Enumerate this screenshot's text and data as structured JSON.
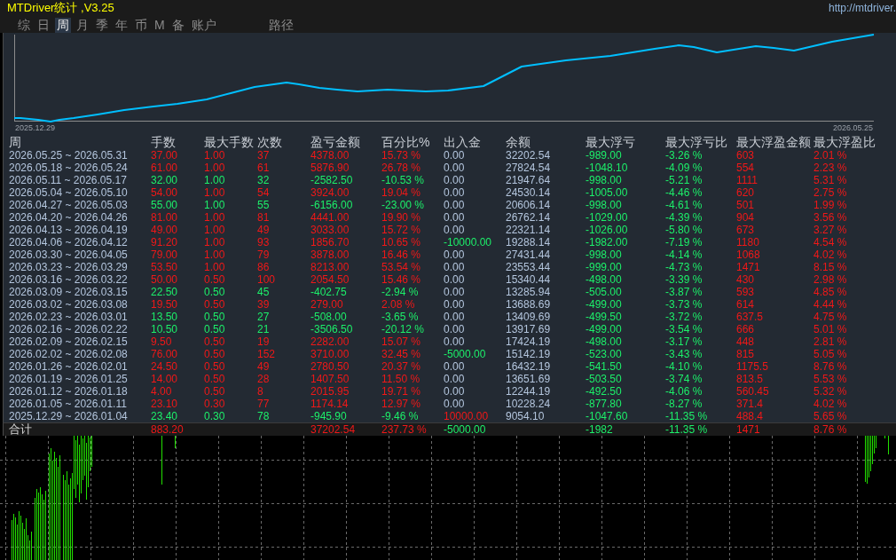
{
  "window": {
    "title": "MTDriver统计 ,V3.25",
    "url": "http://mtdriver."
  },
  "tabs": [
    {
      "label": "综",
      "selected": false
    },
    {
      "label": "日",
      "selected": false
    },
    {
      "label": "周",
      "selected": true
    },
    {
      "label": "月",
      "selected": false
    },
    {
      "label": "季",
      "selected": false
    },
    {
      "label": "年",
      "selected": false
    },
    {
      "label": "币",
      "selected": false
    },
    {
      "label": "M",
      "selected": false
    },
    {
      "label": "备",
      "selected": false
    },
    {
      "label": "账户",
      "selected": false
    }
  ],
  "path_button": {
    "label": "路径"
  },
  "equity_chart": {
    "start_label": "2025.12.29",
    "end_label": "2026.05.25"
  },
  "table": {
    "columns": [
      "周",
      "手数",
      "最大手数",
      "次数",
      "盈亏金额",
      "百分比%",
      "出入金",
      "余额",
      "最大浮亏",
      "最大浮亏比",
      "最大浮盈金额",
      "最大浮盈比"
    ],
    "rows": [
      {
        "week": "2026.05.25 ~ 2026.05.31",
        "lots": "37.00",
        "max_lots": "1.00",
        "trades": "37",
        "profit": "4378.00",
        "percent": "15.73 %",
        "transfer": "0.00",
        "balance": "32202.54",
        "max_drawdown": "-989.00",
        "max_drawdown_pct": "-3.26 %",
        "max_floating_profit": "603",
        "max_floating_profit_pct": "2.01 %",
        "loss": false,
        "deposit": false,
        "withdrawal": false
      },
      {
        "week": "2026.05.18 ~ 2026.05.24",
        "lots": "61.00",
        "max_lots": "1.00",
        "trades": "61",
        "profit": "5876.90",
        "percent": "26.78 %",
        "transfer": "0.00",
        "balance": "27824.54",
        "max_drawdown": "-1048.10",
        "max_drawdown_pct": "-4.09 %",
        "max_floating_profit": "554",
        "max_floating_profit_pct": "2.23 %",
        "loss": false,
        "deposit": false,
        "withdrawal": false
      },
      {
        "week": "2026.05.11 ~ 2026.05.17",
        "lots": "32.00",
        "max_lots": "1.00",
        "trades": "32",
        "profit": "-2582.50",
        "percent": "-10.53 %",
        "transfer": "0.00",
        "balance": "21947.64",
        "max_drawdown": "-998.00",
        "max_drawdown_pct": "-5.21 %",
        "max_floating_profit": "1111",
        "max_floating_profit_pct": "5.31 %",
        "loss": true,
        "deposit": false,
        "withdrawal": false
      },
      {
        "week": "2026.05.04 ~ 2026.05.10",
        "lots": "54.00",
        "max_lots": "1.00",
        "trades": "54",
        "profit": "3924.00",
        "percent": "19.04 %",
        "transfer": "0.00",
        "balance": "24530.14",
        "max_drawdown": "-1005.00",
        "max_drawdown_pct": "-4.46 %",
        "max_floating_profit": "620",
        "max_floating_profit_pct": "2.75 %",
        "loss": false,
        "deposit": false,
        "withdrawal": false
      },
      {
        "week": "2026.04.27 ~ 2026.05.03",
        "lots": "55.00",
        "max_lots": "1.00",
        "trades": "55",
        "profit": "-6156.00",
        "percent": "-23.00 %",
        "transfer": "0.00",
        "balance": "20606.14",
        "max_drawdown": "-998.00",
        "max_drawdown_pct": "-4.61 %",
        "max_floating_profit": "501",
        "max_floating_profit_pct": "1.99 %",
        "loss": true,
        "deposit": false,
        "withdrawal": false
      },
      {
        "week": "2026.04.20 ~ 2026.04.26",
        "lots": "81.00",
        "max_lots": "1.00",
        "trades": "81",
        "profit": "4441.00",
        "percent": "19.90 %",
        "transfer": "0.00",
        "balance": "26762.14",
        "max_drawdown": "-1029.00",
        "max_drawdown_pct": "-4.39 %",
        "max_floating_profit": "904",
        "max_floating_profit_pct": "3.56 %",
        "loss": false,
        "deposit": false,
        "withdrawal": false
      },
      {
        "week": "2026.04.13 ~ 2026.04.19",
        "lots": "49.00",
        "max_lots": "1.00",
        "trades": "49",
        "profit": "3033.00",
        "percent": "15.72 %",
        "transfer": "0.00",
        "balance": "22321.14",
        "max_drawdown": "-1026.00",
        "max_drawdown_pct": "-5.80 %",
        "max_floating_profit": "673",
        "max_floating_profit_pct": "3.27 %",
        "loss": false,
        "deposit": false,
        "withdrawal": false
      },
      {
        "week": "2026.04.06 ~ 2026.04.12",
        "lots": "91.20",
        "max_lots": "1.00",
        "trades": "93",
        "profit": "1856.70",
        "percent": "10.65 %",
        "transfer": "-10000.00",
        "balance": "19288.14",
        "max_drawdown": "-1982.00",
        "max_drawdown_pct": "-7.19 %",
        "max_floating_profit": "1180",
        "max_floating_profit_pct": "4.54 %",
        "loss": false,
        "deposit": false,
        "withdrawal": true
      },
      {
        "week": "2026.03.30 ~ 2026.04.05",
        "lots": "79.00",
        "max_lots": "1.00",
        "trades": "79",
        "profit": "3878.00",
        "percent": "16.46 %",
        "transfer": "0.00",
        "balance": "27431.44",
        "max_drawdown": "-998.00",
        "max_drawdown_pct": "-4.14 %",
        "max_floating_profit": "1068",
        "max_floating_profit_pct": "4.02 %",
        "loss": false,
        "deposit": false,
        "withdrawal": false
      },
      {
        "week": "2026.03.23 ~ 2026.03.29",
        "lots": "53.50",
        "max_lots": "1.00",
        "trades": "86",
        "profit": "8213.00",
        "percent": "53.54 %",
        "transfer": "0.00",
        "balance": "23553.44",
        "max_drawdown": "-999.00",
        "max_drawdown_pct": "-4.73 %",
        "max_floating_profit": "1471",
        "max_floating_profit_pct": "8.15 %",
        "loss": false,
        "deposit": false,
        "withdrawal": false
      },
      {
        "week": "2026.03.16 ~ 2026.03.22",
        "lots": "50.00",
        "max_lots": "0.50",
        "trades": "100",
        "profit": "2054.50",
        "percent": "15.46 %",
        "transfer": "0.00",
        "balance": "15340.44",
        "max_drawdown": "-498.00",
        "max_drawdown_pct": "-3.39 %",
        "max_floating_profit": "430",
        "max_floating_profit_pct": "2.98 %",
        "loss": false,
        "deposit": false,
        "withdrawal": false
      },
      {
        "week": "2026.03.09 ~ 2026.03.15",
        "lots": "22.50",
        "max_lots": "0.50",
        "trades": "45",
        "profit": "-402.75",
        "percent": "-2.94 %",
        "transfer": "0.00",
        "balance": "13285.94",
        "max_drawdown": "-505.00",
        "max_drawdown_pct": "-3.87 %",
        "max_floating_profit": "593",
        "max_floating_profit_pct": "4.85 %",
        "loss": true,
        "deposit": false,
        "withdrawal": false
      },
      {
        "week": "2026.03.02 ~ 2026.03.08",
        "lots": "19.50",
        "max_lots": "0.50",
        "trades": "39",
        "profit": "279.00",
        "percent": "2.08 %",
        "transfer": "0.00",
        "balance": "13688.69",
        "max_drawdown": "-499.00",
        "max_drawdown_pct": "-3.73 %",
        "max_floating_profit": "614",
        "max_floating_profit_pct": "4.44 %",
        "loss": false,
        "deposit": false,
        "withdrawal": false
      },
      {
        "week": "2026.02.23 ~ 2026.03.01",
        "lots": "13.50",
        "max_lots": "0.50",
        "trades": "27",
        "profit": "-508.00",
        "percent": "-3.65 %",
        "transfer": "0.00",
        "balance": "13409.69",
        "max_drawdown": "-499.50",
        "max_drawdown_pct": "-3.72 %",
        "max_floating_profit": "637.5",
        "max_floating_profit_pct": "4.75 %",
        "loss": true,
        "deposit": false,
        "withdrawal": false
      },
      {
        "week": "2026.02.16 ~ 2026.02.22",
        "lots": "10.50",
        "max_lots": "0.50",
        "trades": "21",
        "profit": "-3506.50",
        "percent": "-20.12 %",
        "transfer": "0.00",
        "balance": "13917.69",
        "max_drawdown": "-499.00",
        "max_drawdown_pct": "-3.54 %",
        "max_floating_profit": "666",
        "max_floating_profit_pct": "5.01 %",
        "loss": true,
        "deposit": false,
        "withdrawal": false
      },
      {
        "week": "2026.02.09 ~ 2026.02.15",
        "lots": "9.50",
        "max_lots": "0.50",
        "trades": "19",
        "profit": "2282.00",
        "percent": "15.07 %",
        "transfer": "0.00",
        "balance": "17424.19",
        "max_drawdown": "-498.00",
        "max_drawdown_pct": "-3.17 %",
        "max_floating_profit": "448",
        "max_floating_profit_pct": "2.81 %",
        "loss": false,
        "deposit": false,
        "withdrawal": false
      },
      {
        "week": "2026.02.02 ~ 2026.02.08",
        "lots": "76.00",
        "max_lots": "0.50",
        "trades": "152",
        "profit": "3710.00",
        "percent": "32.45 %",
        "transfer": "-5000.00",
        "balance": "15142.19",
        "max_drawdown": "-523.00",
        "max_drawdown_pct": "-3.43 %",
        "max_floating_profit": "815",
        "max_floating_profit_pct": "5.05 %",
        "loss": false,
        "deposit": false,
        "withdrawal": true
      },
      {
        "week": "2026.01.26 ~ 2026.02.01",
        "lots": "24.50",
        "max_lots": "0.50",
        "trades": "49",
        "profit": "2780.50",
        "percent": "20.37 %",
        "transfer": "0.00",
        "balance": "16432.19",
        "max_drawdown": "-541.50",
        "max_drawdown_pct": "-4.10 %",
        "max_floating_profit": "1175.5",
        "max_floating_profit_pct": "8.76 %",
        "loss": false,
        "deposit": false,
        "withdrawal": false
      },
      {
        "week": "2026.01.19 ~ 2026.01.25",
        "lots": "14.00",
        "max_lots": "0.50",
        "trades": "28",
        "profit": "1407.50",
        "percent": "11.50 %",
        "transfer": "0.00",
        "balance": "13651.69",
        "max_drawdown": "-503.50",
        "max_drawdown_pct": "-3.74 %",
        "max_floating_profit": "813.5",
        "max_floating_profit_pct": "5.53 %",
        "loss": false,
        "deposit": false,
        "withdrawal": false
      },
      {
        "week": "2026.01.12 ~ 2026.01.18",
        "lots": "4.00",
        "max_lots": "0.50",
        "trades": "8",
        "profit": "2015.95",
        "percent": "19.71 %",
        "transfer": "0.00",
        "balance": "12244.19",
        "max_drawdown": "-492.50",
        "max_drawdown_pct": "-4.06 %",
        "max_floating_profit": "560.45",
        "max_floating_profit_pct": "5.32 %",
        "loss": false,
        "deposit": false,
        "withdrawal": false
      },
      {
        "week": "2026.01.05 ~ 2026.01.11",
        "lots": "23.10",
        "max_lots": "0.30",
        "trades": "77",
        "profit": "1174.14",
        "percent": "12.97 %",
        "transfer": "0.00",
        "balance": "10228.24",
        "max_drawdown": "-877.80",
        "max_drawdown_pct": "-8.27 %",
        "max_floating_profit": "371.4",
        "max_floating_profit_pct": "4.02 %",
        "loss": false,
        "deposit": false,
        "withdrawal": false
      },
      {
        "week": "2025.12.29 ~ 2026.01.04",
        "lots": "23.40",
        "max_lots": "0.30",
        "trades": "78",
        "profit": "-945.90",
        "percent": "-9.46 %",
        "transfer": "10000.00",
        "balance": "9054.10",
        "max_drawdown": "-1047.60",
        "max_drawdown_pct": "-11.35 %",
        "max_floating_profit": "488.4",
        "max_floating_profit_pct": "5.65 %",
        "loss": true,
        "deposit": true,
        "withdrawal": false
      }
    ],
    "total": {
      "label": "合计",
      "lots": "883.20",
      "profit": "37202.54",
      "percent": "237.73 %",
      "transfer": "-5000.00",
      "max_drawdown": "-1982",
      "max_drawdown_pct": "-11.35 %",
      "max_floating_profit": "1471",
      "max_floating_profit_pct": "8.76 %",
      "loss": false,
      "deposit": false,
      "withdrawal": true
    }
  }
}
